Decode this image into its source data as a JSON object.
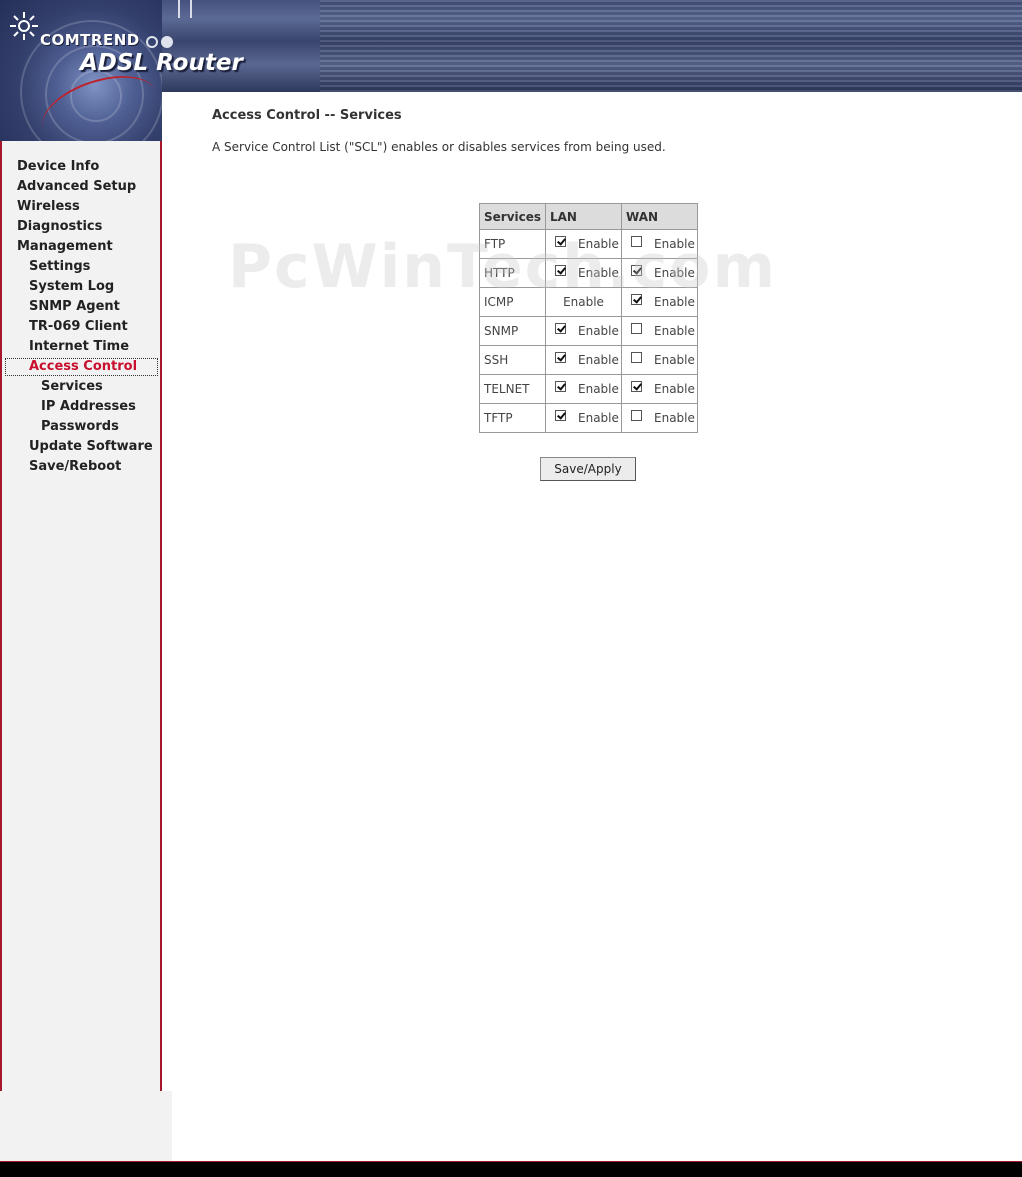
{
  "header": {
    "brand": "COMTREND",
    "product": "ADSL Router",
    "logo_icon": "sun-burst-icon"
  },
  "sidebar": {
    "items": [
      {
        "label": "Device Info",
        "level": 1
      },
      {
        "label": "Advanced Setup",
        "level": 1
      },
      {
        "label": "Wireless",
        "level": 1
      },
      {
        "label": "Diagnostics",
        "level": 1
      },
      {
        "label": "Management",
        "level": 1
      },
      {
        "label": "Settings",
        "level": 2
      },
      {
        "label": "System Log",
        "level": 2
      },
      {
        "label": "SNMP Agent",
        "level": 2
      },
      {
        "label": "TR-069 Client",
        "level": 2
      },
      {
        "label": "Internet Time",
        "level": 2
      },
      {
        "label": "Access Control",
        "level": 2,
        "active": true
      },
      {
        "label": "Services",
        "level": 3
      },
      {
        "label": "IP Addresses",
        "level": 3
      },
      {
        "label": "Passwords",
        "level": 3
      },
      {
        "label": "Update Software",
        "level": 2
      },
      {
        "label": "Save/Reboot",
        "level": 2
      }
    ],
    "active_color": "#c8102e"
  },
  "main": {
    "title": "Access Control -- Services",
    "description": "A Service Control List (\"SCL\") enables or disables services from being used.",
    "watermark": "PcWinTech.com",
    "table": {
      "headers": [
        "Services",
        "LAN",
        "WAN"
      ],
      "rows": [
        {
          "service": "FTP",
          "lan": {
            "checkbox": true,
            "checked": true,
            "label": "Enable"
          },
          "wan": {
            "checkbox": true,
            "checked": false,
            "label": "Enable"
          }
        },
        {
          "service": "HTTP",
          "lan": {
            "checkbox": true,
            "checked": true,
            "label": "Enable"
          },
          "wan": {
            "checkbox": true,
            "checked": true,
            "label": "Enable"
          }
        },
        {
          "service": "ICMP",
          "lan": {
            "checkbox": false,
            "checked": false,
            "label": "Enable"
          },
          "wan": {
            "checkbox": true,
            "checked": true,
            "label": "Enable"
          }
        },
        {
          "service": "SNMP",
          "lan": {
            "checkbox": true,
            "checked": true,
            "label": "Enable"
          },
          "wan": {
            "checkbox": true,
            "checked": false,
            "label": "Enable"
          }
        },
        {
          "service": "SSH",
          "lan": {
            "checkbox": true,
            "checked": true,
            "label": "Enable"
          },
          "wan": {
            "checkbox": true,
            "checked": false,
            "label": "Enable"
          }
        },
        {
          "service": "TELNET",
          "lan": {
            "checkbox": true,
            "checked": true,
            "label": "Enable"
          },
          "wan": {
            "checkbox": true,
            "checked": true,
            "label": "Enable"
          }
        },
        {
          "service": "TFTP",
          "lan": {
            "checkbox": true,
            "checked": true,
            "label": "Enable"
          },
          "wan": {
            "checkbox": true,
            "checked": false,
            "label": "Enable"
          }
        }
      ]
    },
    "save_label": "Save/Apply"
  }
}
